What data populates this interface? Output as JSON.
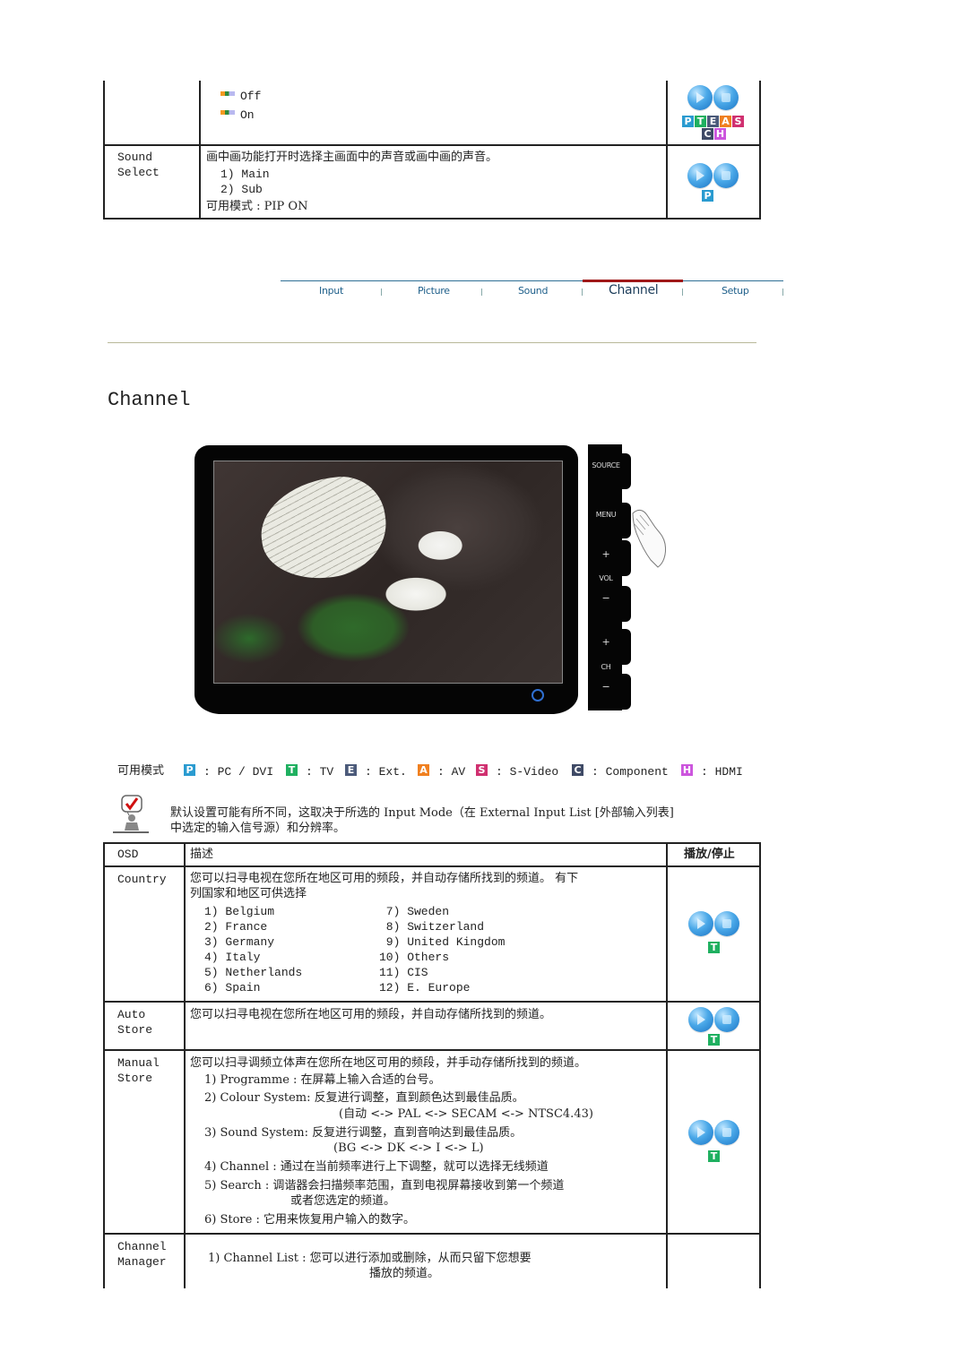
{
  "top_table": {
    "rows": [
      {
        "osd": "",
        "options": [
          {
            "bullet": "option-bullet",
            "label": "Off"
          },
          {
            "bullet": "option-bullet",
            "label": "On"
          }
        ],
        "modes": [
          "P",
          "T",
          "E",
          "A",
          "S",
          "C",
          "H"
        ]
      },
      {
        "osd_line1": "Sound",
        "osd_line2": "Select",
        "desc": "画中画功能打开时选择主画面中的声音或画中画的声音。",
        "items": [
          "1) Main",
          "2) Sub"
        ],
        "available": "可用模式 : PIP ON",
        "modes": [
          "P"
        ]
      }
    ]
  },
  "nav": {
    "tabs": [
      {
        "label": "Input",
        "active": false
      },
      {
        "label": "Picture",
        "active": false
      },
      {
        "label": "Sound",
        "active": false
      },
      {
        "label": "Channel",
        "active": true
      },
      {
        "label": "Setup",
        "active": false
      }
    ],
    "active_color": "#a01818",
    "line_color": "#2e6f96"
  },
  "page_title": "Channel",
  "monitor": {
    "buttons": [
      "SOURCE",
      "MENU",
      "+",
      "VOL",
      "−",
      "+",
      "CH",
      "−"
    ]
  },
  "modes_legend": {
    "label": "可用模式",
    "items": [
      {
        "badge": "P",
        "text": ": PC / DVI",
        "color": "#2a9bd0"
      },
      {
        "badge": "T",
        "text": ": TV",
        "color": "#1fb060"
      },
      {
        "badge": "E",
        "text": ": Ext.",
        "color": "#4b5a7a"
      },
      {
        "badge": "A",
        "text": ": AV",
        "color": "#f08020"
      },
      {
        "badge": "S",
        "text": ": S-Video",
        "color": "#d03070"
      },
      {
        "badge": "C",
        "text": ": Component",
        "color": "#3f4a66"
      },
      {
        "badge": "H",
        "text": ": HDMI",
        "color": "#cc55dd"
      }
    ]
  },
  "note": {
    "line1": "默认设置可能有所不同，这取决于所选的 Input Mode（在 External Input List [外部输入列表]",
    "line2": "中选定的输入信号源）和分辨率。"
  },
  "main_table": {
    "headers": {
      "osd": "OSD",
      "desc": "描述",
      "play": "播放/停止"
    },
    "country": {
      "osd": "Country",
      "desc1": "您可以扫寻电视在您所在地区可用的频段，并自动存储所找到的频道。 有下",
      "desc2": "列国家和地区可供选择",
      "left": [
        "1) Belgium",
        "2) France",
        "3) Germany",
        "4) Italy",
        "5) Netherlands",
        "6) Spain"
      ],
      "right": [
        " 7) Sweden",
        " 8) Switzerland",
        " 9) United Kingdom",
        "10) Others",
        "11) CIS",
        "12) E. Europe"
      ],
      "mode": "T"
    },
    "auto_store": {
      "osd1": "Auto",
      "osd2": "Store",
      "desc": "您可以扫寻电视在您所在地区可用的频段，并自动存储所找到的频道。",
      "mode": "T"
    },
    "manual_store": {
      "osd1": "Manual",
      "osd2": "Store",
      "desc": "您可以扫寻调频立体声在您所在地区可用的频段，并手动存储所找到的频道。",
      "i1": "1) Programme : 在屏幕上输入合适的台号。",
      "i2": "2) Colour System: 反复进行调整，直到颜色达到最佳品质。",
      "i2b": "(自动 <-> PAL <-> SECAM <-> NTSC4.43)",
      "i3": "3) Sound System: 反复进行调整，直到音响达到最佳品质。",
      "i3b": "(BG <-> DK <-> I <-> L)",
      "i4": "4) Channel : 通过在当前频率进行上下调整，就可以选择无线频道",
      "i5": "5) Search : 调谐器会扫描频率范围，直到电视屏幕接收到第一个频道",
      "i5b": "或者您选定的频道。",
      "i6": "6) Store : 它用来恢复用户输入的数字。",
      "mode": "T"
    },
    "channel_manager": {
      "osd1": "Channel",
      "osd2": "Manager",
      "i1": "1) Channel List : 您可以进行添加或删除，从而只留下您想要",
      "i1b": "播放的频道。"
    }
  }
}
